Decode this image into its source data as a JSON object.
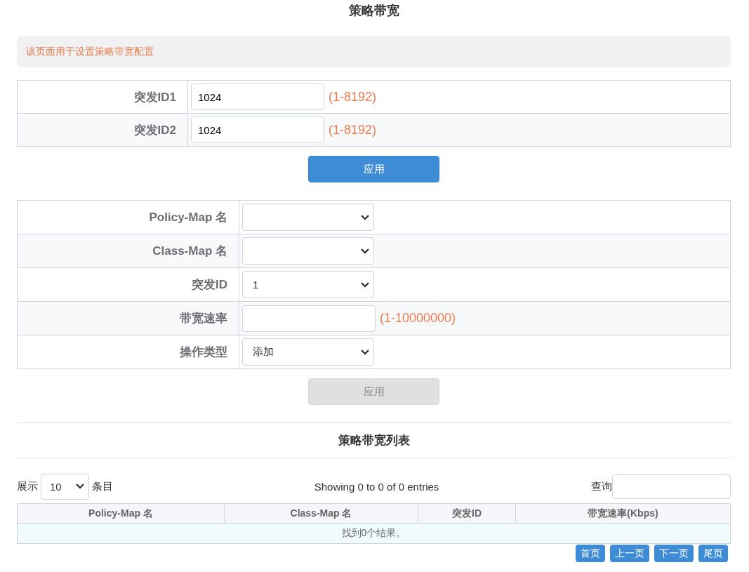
{
  "title": "策略带宽",
  "notice": "该页面用于设置策略带宽配置",
  "burst_form": {
    "rows": [
      {
        "label": "突发ID1",
        "kind": "input",
        "value": "1024",
        "hint": "(1-8192)"
      },
      {
        "label": "突发ID2",
        "kind": "input",
        "value": "1024",
        "hint": "(1-8192)"
      }
    ]
  },
  "burst_apply": {
    "label": "应用",
    "disabled": false
  },
  "policy_form": {
    "rows": [
      {
        "label": "Policy-Map 名",
        "kind": "select"
      },
      {
        "label": "Class-Map 名",
        "kind": "select"
      },
      {
        "label": "突发ID",
        "kind": "select",
        "value": "1"
      },
      {
        "label": "带宽速率",
        "kind": "input",
        "hint": "(1-10000000)"
      },
      {
        "label": "操作类型",
        "kind": "select",
        "value": "添加"
      }
    ]
  },
  "policy_apply": {
    "label": "应用",
    "disabled": true
  },
  "list": {
    "title": "策略带宽列表",
    "length_prefix": "展示",
    "length_value": "10",
    "length_suffix": "条目",
    "info": "Showing 0 to 0 of 0 entries",
    "search_label": "查询",
    "columns": [
      "Policy-Map 名",
      "Class-Map 名",
      "突发ID",
      "带宽速率(Kbps)"
    ],
    "empty_message": "找到0个结果。",
    "pager": [
      "首页",
      "上一页",
      "下一页",
      "尾页"
    ]
  }
}
